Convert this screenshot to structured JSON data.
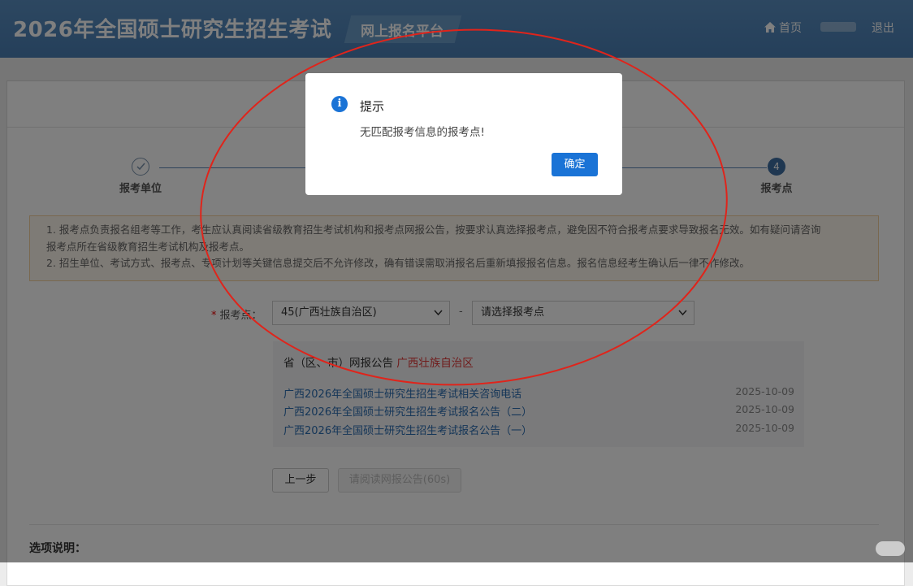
{
  "header": {
    "title": "2026年全国硕士研究生招生考试",
    "platform": "网上报名平台",
    "home_label": "首页",
    "logout_label": "退出"
  },
  "steps": [
    {
      "label": "报考单位",
      "status": "done"
    },
    {
      "label": "报考点",
      "number": "4",
      "status": "current"
    }
  ],
  "notice": {
    "lines": [
      "1. 报考点负责报名组考等工作，考生应认真阅读省级教育招生考试机构和报考点网报公告，按要求认真选择报考点，避免因不符合报考点要求导致报名无效。如有疑问请咨询",
      "报考点所在省级教育招生考试机构及报考点。",
      "2. 招生单位、考试方式、报考点、专项计划等关键信息提交后不允许修改，确有错误需取消报名后重新填报报名信息。报名信息经考生确认后一律不作修改。"
    ]
  },
  "form": {
    "required_mark": "*",
    "label": "报考点：",
    "province_value": "45(广西壮族自治区)",
    "separator": "-",
    "site_placeholder": "请选择报考点"
  },
  "announcements": {
    "heading_prefix": "省（区、市）网报公告",
    "province": "广西壮族自治区",
    "items": [
      {
        "title": "广西2026年全国硕士研究生招生考试相关咨询电话",
        "date": "2025-10-09"
      },
      {
        "title": "广西2026年全国硕士研究生招生考试报名公告（二）",
        "date": "2025-10-09"
      },
      {
        "title": "广西2026年全国硕士研究生招生考试报名公告（一）",
        "date": "2025-10-09"
      }
    ]
  },
  "buttons": {
    "prev": "上一步",
    "wait": "请阅读网报公告(60s)"
  },
  "options_title": "选项说明：",
  "dialog": {
    "icon_glyph": "i",
    "title": "提示",
    "message": "无匹配报考信息的报考点!",
    "ok": "确定"
  },
  "colors": {
    "header_bg": "#4a7fb5",
    "primary": "#1a73d6",
    "annotation_red": "#e0241b",
    "province_red": "#e03a3a",
    "link_blue": "#2b6cb0"
  }
}
